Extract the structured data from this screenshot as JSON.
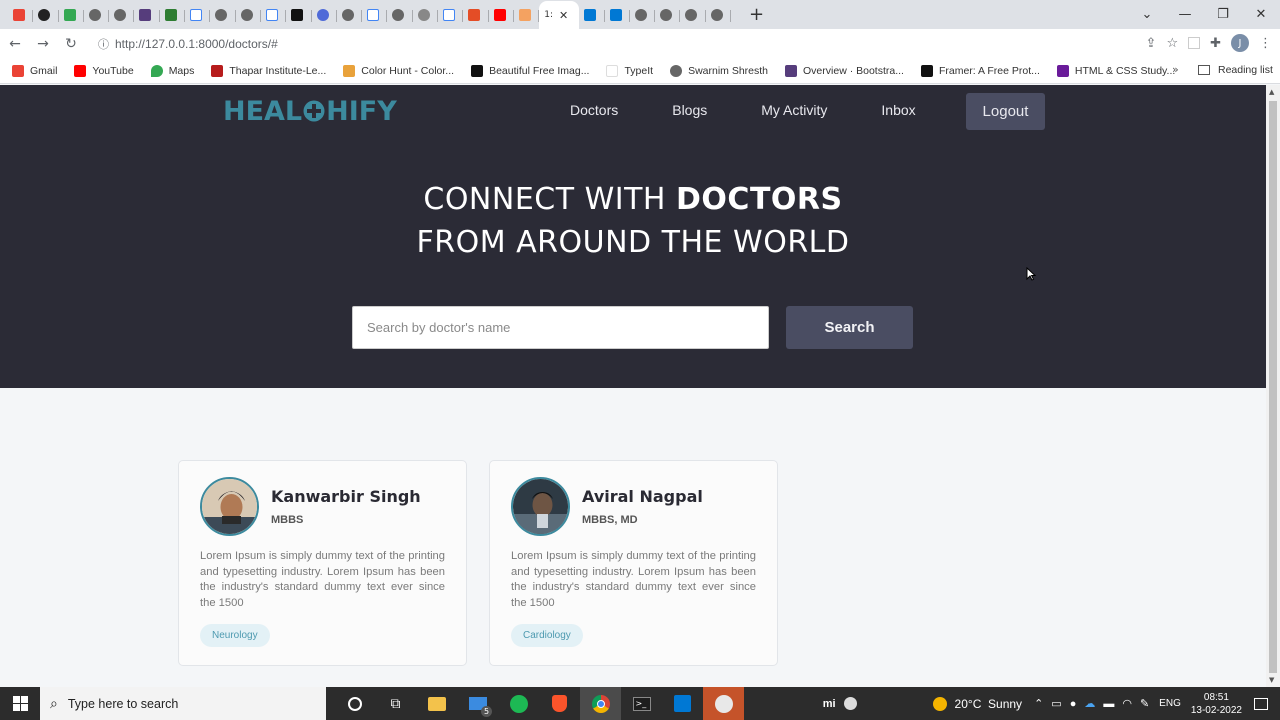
{
  "browser": {
    "active_tab_label": "1:",
    "url": "http://127.0.0.1:8000/doctors/#",
    "profile_initial": "J",
    "bookmarks": [
      "Gmail",
      "YouTube",
      "Maps",
      "Thapar Institute-Le...",
      "Color Hunt - Color...",
      "Beautiful Free Imag...",
      "TypeIt",
      "Swarnim Shresth",
      "Overview · Bootstra...",
      "Framer: A Free Prot...",
      "HTML & CSS Study..."
    ],
    "more_bookmarks": "»",
    "reading_list": "Reading list"
  },
  "site": {
    "logo_left": "HEAL",
    "logo_right": "HIFY",
    "nav": [
      "Doctors",
      "Blogs",
      "My Activity",
      "Inbox"
    ],
    "logout_label": "Logout",
    "headline_line1_light": "CONNECT WITH ",
    "headline_line1_bold": "DOCTORS",
    "headline_line2": "FROM AROUND THE WORLD",
    "search_placeholder": "Search by doctor's name",
    "search_button": "Search"
  },
  "doctors": [
    {
      "name": "Kanwarbir Singh",
      "degree": "MBBS",
      "description": "Lorem Ipsum is simply dummy text of the printing and typesetting industry. Lorem Ipsum has been the industry's standard dummy text ever since the 1500",
      "specialty": "Neurology"
    },
    {
      "name": "Aviral Nagpal",
      "degree": "MBBS, MD",
      "description": "Lorem Ipsum is simply dummy text of the printing and typesetting industry. Lorem Ipsum has been the industry's standard dummy text ever since the 1500",
      "specialty": "Cardiology"
    }
  ],
  "taskbar": {
    "search_placeholder": "Type here to search",
    "mail_badge": "5",
    "weather": "20°C  Sunny",
    "language": "ENG",
    "time": "08:51",
    "date": "13-02-2022"
  },
  "colors": {
    "hero_bg": "#2b2b36",
    "accent_teal": "#3c8a9e",
    "button_bg": "#4a4d62"
  }
}
